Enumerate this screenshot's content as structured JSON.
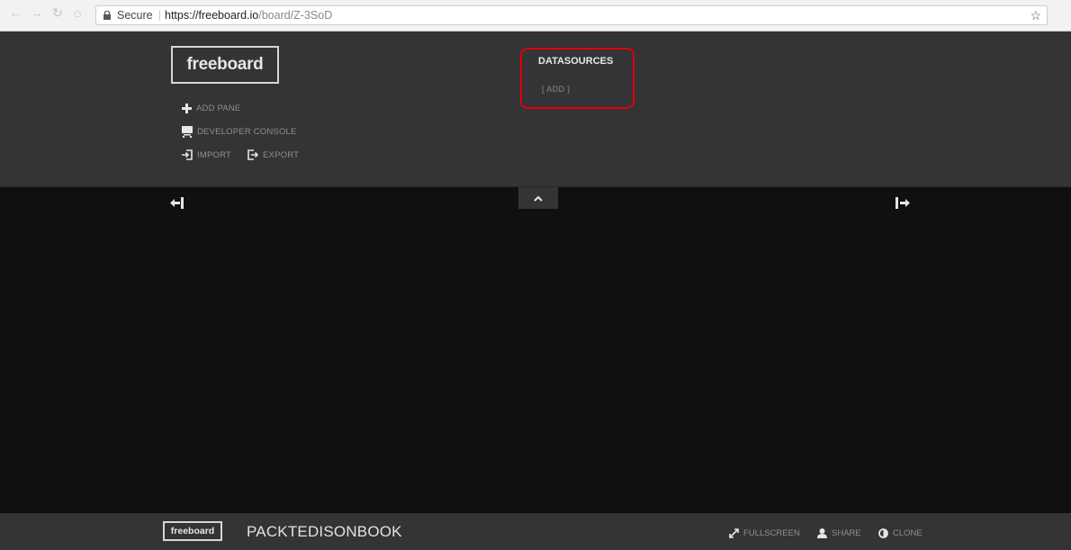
{
  "browser": {
    "secure_label": "Secure",
    "url_host": "https://freeboard.io",
    "url_path": "/board/Z-3SoD"
  },
  "header": {
    "logo": "freeboard",
    "menu": {
      "add_pane": "ADD PANE",
      "developer_console": "DEVELOPER CONSOLE",
      "import": "IMPORT",
      "export": "EXPORT"
    },
    "datasources": {
      "title": "DATASOURCES",
      "add": "[ ADD ]"
    }
  },
  "footer": {
    "logo": "freeboard",
    "board_name": "PACKTEDISONBOOK",
    "fullscreen": "FULLSCREEN",
    "share": "SHARE",
    "clone": "CLONE"
  },
  "colors": {
    "panel": "#343436",
    "board_bg": "#101012",
    "highlight": "#e0000a"
  },
  "icons": [
    "lock-icon",
    "star-icon",
    "plus-icon",
    "monitor-icon",
    "import-icon",
    "export-icon",
    "chevron-up-icon",
    "collapse-left-icon",
    "expand-right-icon",
    "fullscreen-icon",
    "user-icon",
    "clone-icon"
  ]
}
